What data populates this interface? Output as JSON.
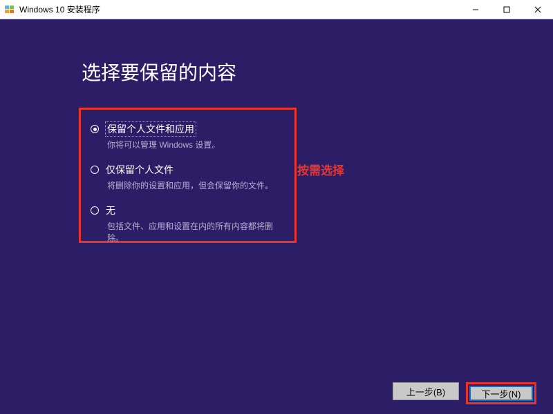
{
  "window": {
    "title": "Windows 10 安装程序"
  },
  "page": {
    "title": "选择要保留的内容"
  },
  "options": [
    {
      "label": "保留个人文件和应用",
      "desc": "你将可以管理 Windows 设置。",
      "selected": true
    },
    {
      "label": "仅保留个人文件",
      "desc": "将删除你的设置和应用，但会保留你的文件。",
      "selected": false
    },
    {
      "label": "无",
      "desc": "包括文件、应用和设置在内的所有内容都将删除。",
      "selected": false
    }
  ],
  "annotation": "按需选择",
  "buttons": {
    "back": "上一步(B)",
    "next": "下一步(N)"
  },
  "colors": {
    "highlight": "#e8342b",
    "background": "#2b1d66"
  }
}
